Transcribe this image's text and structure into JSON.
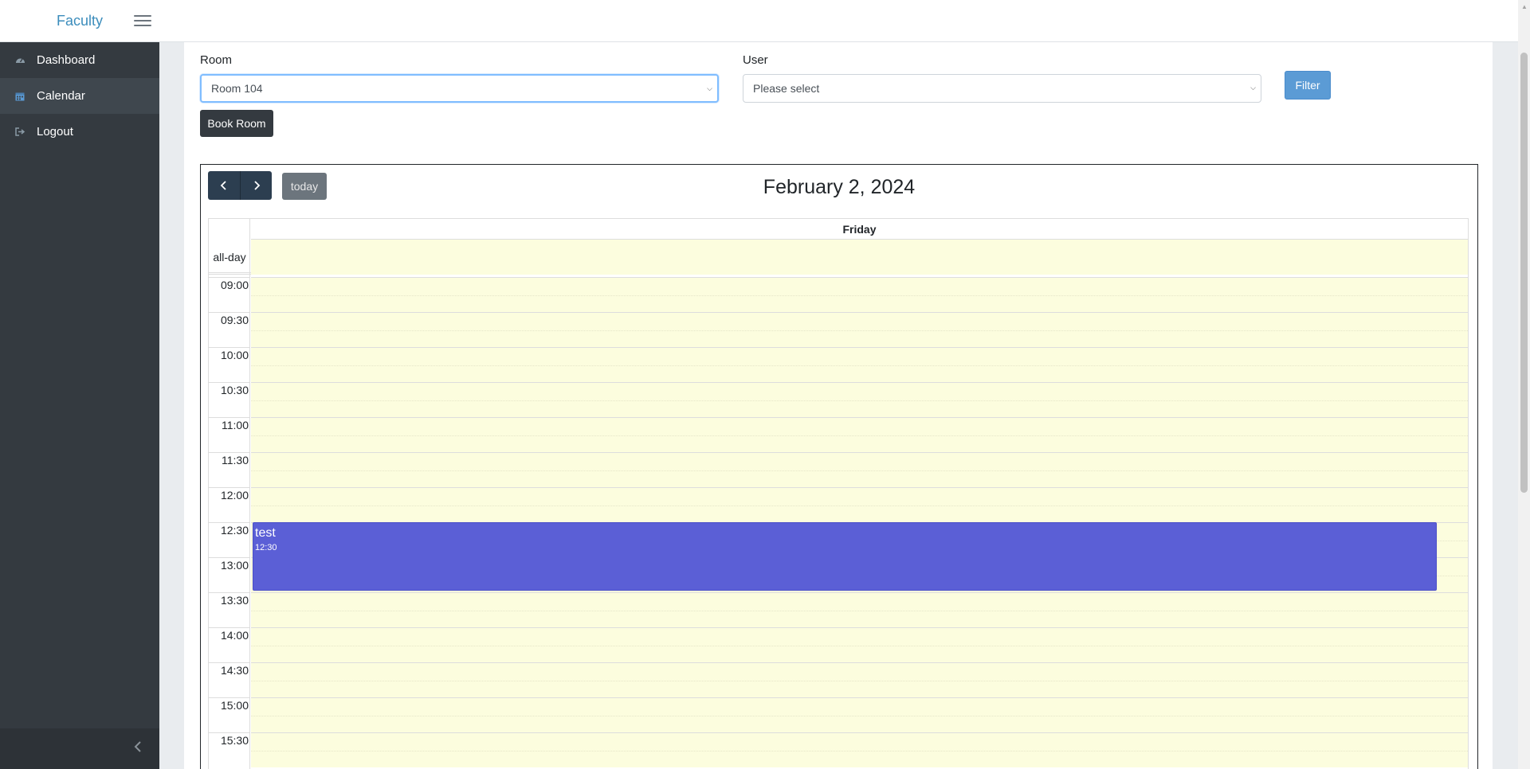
{
  "header": {
    "brand": "Faculty",
    "menu_icon": "hamburger-icon"
  },
  "sidebar": {
    "items": [
      {
        "label": "Dashboard",
        "icon": "tachometer-icon",
        "active": false
      },
      {
        "label": "Calendar",
        "icon": "calendar-icon",
        "active": true
      },
      {
        "label": "Logout",
        "icon": "sign-out-icon",
        "active": false
      }
    ],
    "collapse_icon": "chevron-left-icon"
  },
  "filters": {
    "room_label": "Room",
    "room_value": "Room 104",
    "user_label": "User",
    "user_value": "Please select",
    "filter_button": "Filter",
    "book_button": "Book Room"
  },
  "calendar": {
    "title": "February 2, 2024",
    "today_button": "today",
    "prev_icon": "chevron-left-icon",
    "next_icon": "chevron-right-icon",
    "day_header": "Friday",
    "allday_label": "all-day",
    "time_labels": [
      "09:00",
      "09:30",
      "10:00",
      "10:30",
      "11:00",
      "11:30",
      "12:00",
      "12:30",
      "13:00",
      "13:30",
      "14:00",
      "14:30",
      "15:00",
      "15:30"
    ],
    "events": [
      {
        "title": "test",
        "time": "12:30",
        "color": "#5b5fd6"
      }
    ]
  },
  "colors": {
    "sidebar_bg": "#343a40",
    "brand": "#3c8dbc",
    "slot_bg": "#fcfdde",
    "filter_btn": "#5b9bd5"
  }
}
